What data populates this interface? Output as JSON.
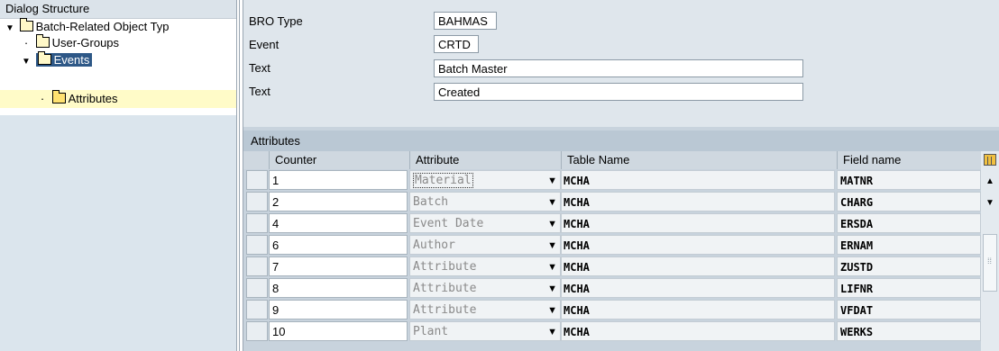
{
  "tree": {
    "header": "Dialog Structure",
    "items": [
      {
        "label": "Batch-Related Object Typ",
        "level": 0,
        "toggle": "▼"
      },
      {
        "label": "User-Groups",
        "level": 1,
        "toggle": "·"
      },
      {
        "label": "Events",
        "level": 1,
        "toggle": "▼"
      },
      {
        "label": "Attributes",
        "level": 2,
        "toggle": "·"
      }
    ]
  },
  "form": {
    "bro_type_label": "BRO Type",
    "bro_type_value": "BAHMAS",
    "event_label": "Event",
    "event_value": "CRTD",
    "text1_label": "Text",
    "text1_value": "Batch Master",
    "text2_label": "Text",
    "text2_value": "Created"
  },
  "table": {
    "title": "Attributes",
    "columns": [
      "Counter",
      "Attribute",
      "Table Name",
      "Field name"
    ],
    "rows": [
      {
        "counter": "1",
        "attribute": "Material",
        "table": "MCHA",
        "field": "MATNR"
      },
      {
        "counter": "2",
        "attribute": "Batch",
        "table": "MCHA",
        "field": "CHARG"
      },
      {
        "counter": "4",
        "attribute": "Event Date",
        "table": "MCHA",
        "field": "ERSDA"
      },
      {
        "counter": "6",
        "attribute": "Author",
        "table": "MCHA",
        "field": "ERNAM"
      },
      {
        "counter": "7",
        "attribute": "Attribute",
        "table": "MCHA",
        "field": "ZUSTD"
      },
      {
        "counter": "8",
        "attribute": "Attribute",
        "table": "MCHA",
        "field": "LIFNR"
      },
      {
        "counter": "9",
        "attribute": "Attribute",
        "table": "MCHA",
        "field": "VFDAT"
      },
      {
        "counter": "10",
        "attribute": "Plant",
        "table": "MCHA",
        "field": "WERKS"
      }
    ]
  },
  "icons": {
    "dropdown": "▼",
    "scroll_up": "▲",
    "scroll_down": "▼"
  },
  "colors": {
    "selected_node": "#2e5887",
    "highlight_row": "#fffbc8"
  }
}
